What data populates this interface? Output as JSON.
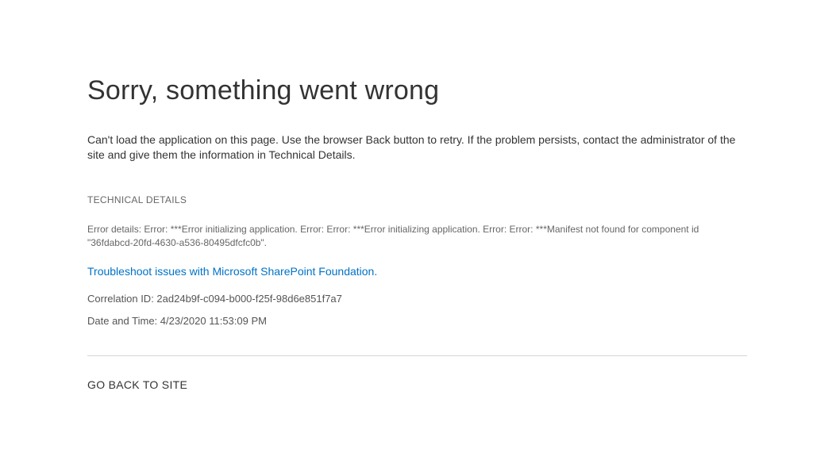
{
  "error": {
    "title": "Sorry, something went wrong",
    "message": "Can't load the application on this page. Use the browser Back button to retry. If the problem persists, contact the administrator of the site and give them the information in Technical Details."
  },
  "technical": {
    "section_label": "TECHNICAL DETAILS",
    "details": "Error details: Error: ***Error initializing application. Error: Error: ***Error initializing application. Error: Error: ***Manifest not found for component id \"36fdabcd-20fd-4630-a536-80495dfcfc0b\".",
    "troubleshoot_link_text": "Troubleshoot issues with Microsoft SharePoint Foundation.",
    "correlation_id_line": "Correlation ID: 2ad24b9f-c094-b000-f25f-98d6e851f7a7",
    "datetime_line": "Date and Time: 4/23/2020 11:53:09 PM"
  },
  "footer": {
    "go_back_label": "GO BACK TO SITE"
  }
}
